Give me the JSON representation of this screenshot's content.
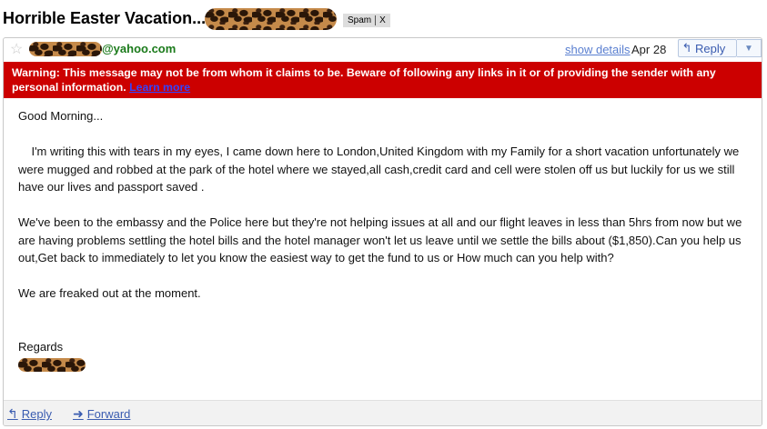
{
  "subject": {
    "title": "Horrible Easter Vacation........",
    "label": "Spam",
    "label_remove": "X"
  },
  "sender": {
    "email": "@yahoo.com"
  },
  "header": {
    "show_details": "show details",
    "date": "Apr 28",
    "reply": "Reply"
  },
  "warning": {
    "text": "Warning: This message may not be from whom it claims to be. Beware of following any links in it or of providing the sender with any personal information.",
    "link": "Learn more"
  },
  "message": {
    "greeting": "Good Morning...",
    "para1": "I'm writing this with tears in my eyes, I came down here to London,United Kingdom with my Family for a short vacation unfortunately we were mugged and robbed at the park of the hotel where we stayed,all cash,credit card and cell were stolen off us  but luckily for us we still have our lives and passport saved .",
    "para2": "We've been to the embassy and the Police here but they're not helping issues at all and our flight  leaves in less than 5hrs from now but we are having problems settling the hotel bills  and the hotel  manager won't let us leave until we settle the bills about ($1,850).Can you help us out,Get back to immediately to let you know the easiest way to get the fund to us or How much can you help with?",
    "para3": "We are  freaked out at the moment.",
    "closing": "Regards"
  },
  "footer": {
    "reply": "Reply",
    "forward": "Forward"
  },
  "icons": {
    "star": "star-icon",
    "reply": "reply-arrow-icon",
    "forward": "forward-arrow-icon",
    "more": "chevron-down-icon"
  },
  "colors": {
    "warning_bg": "#cc0000",
    "sender": "#1a7a1a",
    "link": "#3a5cb0"
  }
}
